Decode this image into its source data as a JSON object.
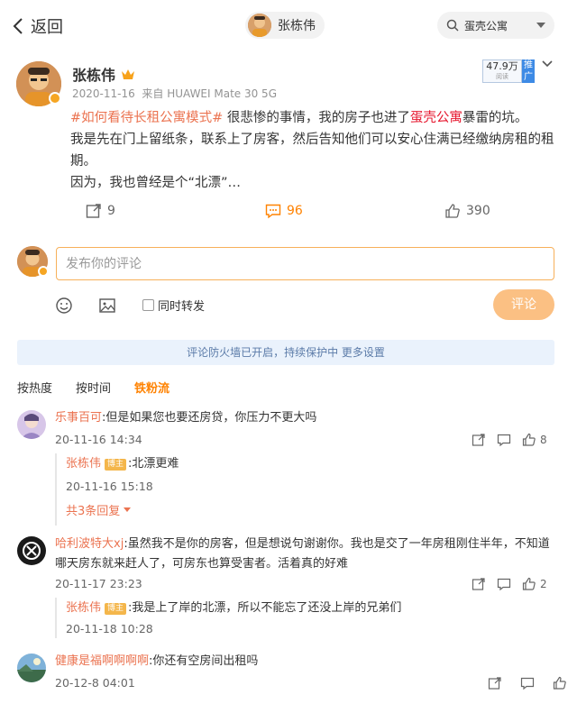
{
  "header": {
    "back_label": "返回",
    "user_chip_name": "张栋伟",
    "search_value": "蛋壳公寓"
  },
  "post": {
    "author": "张栋伟",
    "date": "2020-11-16",
    "source": "来自 HUAWEI Mate 30 5G",
    "views_badge": "47.9万",
    "views_sub": "阅读",
    "push_label": "推广",
    "text_hashtag": "#如何看待长租公寓模式#",
    "text_part1": " 很悲惨的事情，我的房子也进了",
    "text_link": "蛋壳公寓",
    "text_part2": "暴雷的坑。",
    "text_line2": "我是先在门上留纸条，联系上了房客，然后告知他们可以安心住满已经缴纳房租的租期。",
    "text_line3": "因为，我也曾经是个“北漂”…",
    "repost_count": "9",
    "comment_count": "96",
    "like_count": "390"
  },
  "composer": {
    "placeholder": "发布你的评论",
    "repost_label": "同时转发",
    "submit_label": "评论"
  },
  "notice": "评论防火墙已开启，持续保护中 更多设置",
  "sort_tabs": [
    "按热度",
    "按时间",
    "铁粉流"
  ],
  "comments": [
    {
      "user": "乐事百可",
      "text": ":但是如果您也要还房贷，你压力不更大吗",
      "time": "20-11-16 14:34",
      "likes": "8",
      "reply": {
        "user": "张栋伟",
        "tag": "博主",
        "text": ":北漂更难",
        "time": "20-11-16 15:18"
      },
      "more": "共3条回复"
    },
    {
      "user": "哈利波特大xj",
      "text": ":虽然我不是你的房客，但是想说句谢谢你。我也是交了一年房租刚住半年，不知道",
      "text2": "哪天房东就来赶人了，可房东也算受害者。活着真的好难",
      "time": "20-11-17 23:23",
      "likes": "2",
      "reply": {
        "user": "张栋伟",
        "tag": "博主",
        "text": ":我是上了岸的北漂，所以不能忘了还没上岸的兄弟们",
        "time": "20-11-18 10:28"
      }
    },
    {
      "user": "健康是福啊啊啊啊",
      "text": ":你还有空房间出租吗",
      "time": "20-12-8 04:01"
    }
  ],
  "colors": {
    "accent": "#ff8200",
    "link": "#eb7350",
    "red_link": "#e6162d",
    "notice_bg": "#eaf2fc"
  }
}
